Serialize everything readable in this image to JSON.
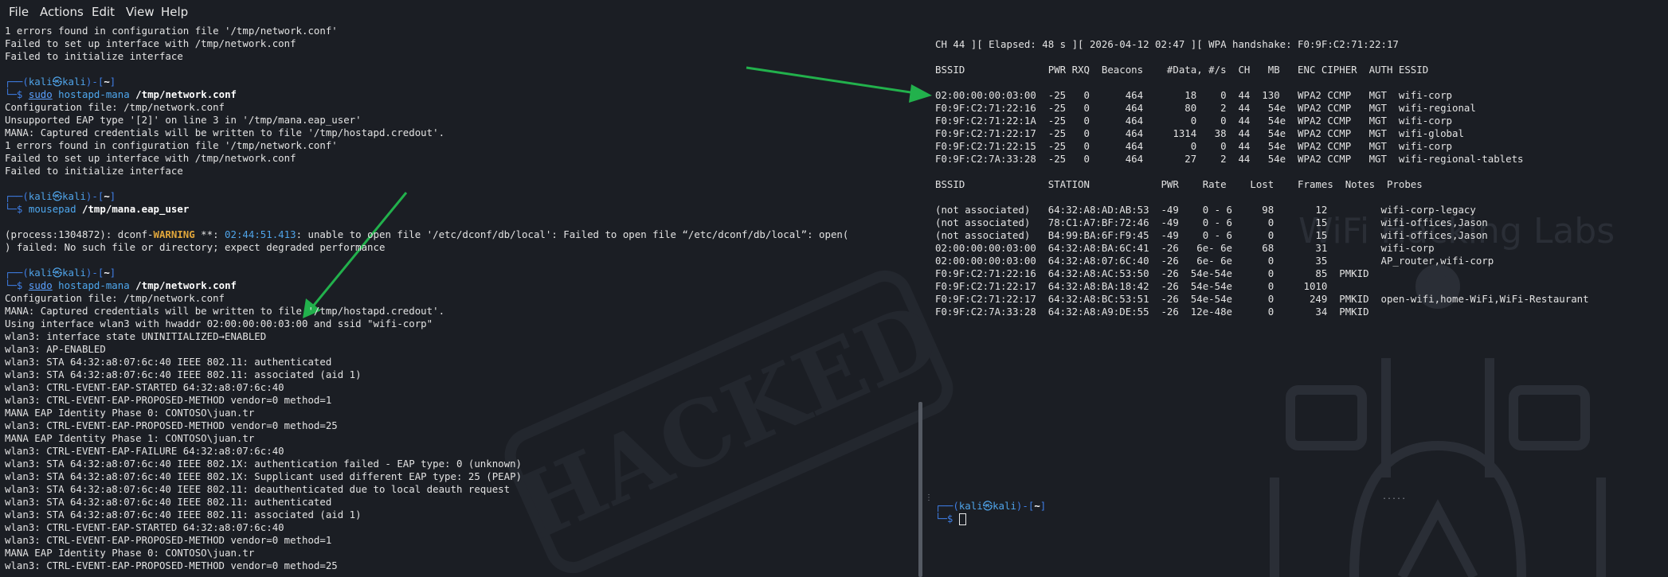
{
  "menu": [
    "File",
    "Actions",
    "Edit",
    "View",
    "Help"
  ],
  "prompt": {
    "user": "kali",
    "host": "kali",
    "dir": "~",
    "sep": "㉿"
  },
  "left": {
    "block1": [
      "1 errors found in configuration file '/tmp/network.conf'",
      "Failed to set up interface with /tmp/network.conf",
      "Failed to initialize interface"
    ],
    "cmd1": {
      "sudo": "sudo",
      "prog": "hostapd-mana",
      "arg": "/tmp/network.conf"
    },
    "block2": [
      "Configuration file: /tmp/network.conf",
      "Unsupported EAP type '[2]' on line 3 in '/tmp/mana.eap_user'",
      "MANA: Captured credentials will be written to file '/tmp/hostapd.credout'.",
      "1 errors found in configuration file '/tmp/network.conf'",
      "Failed to set up interface with /tmp/network.conf",
      "Failed to initialize interface"
    ],
    "cmd2": {
      "prog": "mousepad",
      "arg": "/tmp/mana.eap_user"
    },
    "warn_line": {
      "pre": "(process:1304872): dconf-",
      "warn": "WARNING",
      "mid": " **: ",
      "time": "02:44:51.413",
      "post": ": unable to open file '/etc/dconf/db/local': Failed to open file “/etc/dconf/db/local”: open("
    },
    "warn_cont": ") failed: No such file or directory; expect degraded performance",
    "cmd3": {
      "sudo": "sudo",
      "prog": "hostapd-mana",
      "arg": "/tmp/network.conf"
    },
    "block3": [
      "Configuration file: /tmp/network.conf",
      "MANA: Captured credentials will be written to file '/tmp/hostapd.credout'.",
      "Using interface wlan3 with hwaddr 02:00:00:00:03:00 and ssid \"wifi-corp\"",
      "wlan3: interface state UNINITIALIZED→ENABLED",
      "wlan3: AP-ENABLED",
      "wlan3: STA 64:32:a8:07:6c:40 IEEE 802.11: authenticated",
      "wlan3: STA 64:32:a8:07:6c:40 IEEE 802.11: associated (aid 1)",
      "wlan3: CTRL-EVENT-EAP-STARTED 64:32:a8:07:6c:40",
      "wlan3: CTRL-EVENT-EAP-PROPOSED-METHOD vendor=0 method=1",
      "MANA EAP Identity Phase 0: CONTOSO\\juan.tr",
      "wlan3: CTRL-EVENT-EAP-PROPOSED-METHOD vendor=0 method=25",
      "MANA EAP Identity Phase 1: CONTOSO\\juan.tr",
      "wlan3: CTRL-EVENT-EAP-FAILURE 64:32:a8:07:6c:40",
      "wlan3: STA 64:32:a8:07:6c:40 IEEE 802.1X: authentication failed - EAP type: 0 (unknown)",
      "wlan3: STA 64:32:a8:07:6c:40 IEEE 802.1X: Supplicant used different EAP type: 25 (PEAP)",
      "wlan3: STA 64:32:a8:07:6c:40 IEEE 802.11: deauthenticated due to local deauth request",
      "wlan3: STA 64:32:a8:07:6c:40 IEEE 802.11: authenticated",
      "wlan3: STA 64:32:a8:07:6c:40 IEEE 802.11: associated (aid 1)",
      "wlan3: CTRL-EVENT-EAP-STARTED 64:32:a8:07:6c:40",
      "wlan3: CTRL-EVENT-EAP-PROPOSED-METHOD vendor=0 method=1",
      "MANA EAP Identity Phase 0: CONTOSO\\juan.tr",
      "wlan3: CTRL-EVENT-EAP-PROPOSED-METHOD vendor=0 method=25"
    ]
  },
  "airodump": {
    "status": "CH 44 ][ Elapsed: 48 s ][ 2026-04-12 02:47 ][ WPA handshake: F0:9F:C2:71:22:17",
    "ap_header": "BSSID              PWR RXQ  Beacons    #Data, #/s  CH   MB   ENC CIPHER  AUTH ESSID",
    "ap_rows": [
      "02:00:00:00:03:00  -25   0      464       18    0  44  130   WPA2 CCMP   MGT  wifi-corp",
      "F0:9F:C2:71:22:16  -25   0      464       80    2  44   54e  WPA2 CCMP   MGT  wifi-regional",
      "F0:9F:C2:71:22:1A  -25   0      464        0    0  44   54e  WPA2 CCMP   MGT  wifi-corp",
      "F0:9F:C2:71:22:17  -25   0      464     1314   38  44   54e  WPA2 CCMP   MGT  wifi-global",
      "F0:9F:C2:71:22:15  -25   0      464        0    0  44   54e  WPA2 CCMP   MGT  wifi-corp",
      "F0:9F:C2:7A:33:28  -25   0      464       27    2  44   54e  WPA2 CCMP   MGT  wifi-regional-tablets"
    ],
    "sta_header": "BSSID              STATION            PWR    Rate    Lost    Frames  Notes  Probes",
    "sta_rows": [
      "(not associated)   64:32:A8:AD:AB:53  -49    0 - 6     98       12         wifi-corp-legacy",
      "(not associated)   78:C1:A7:BF:72:46  -49    0 - 6      0       15         wifi-offices,Jason",
      "(not associated)   B4:99:BA:6F:F9:45  -49    0 - 6      0       15         wifi-offices,Jason",
      "02:00:00:00:03:00  64:32:A8:BA:6C:41  -26   6e- 6e     68       31         wifi-corp",
      "02:00:00:00:03:00  64:32:A8:07:6C:40  -26   6e- 6e      0       35         AP_router,wifi-corp",
      "F0:9F:C2:71:22:16  64:32:A8:AC:53:50  -26  54e-54e      0       85  PMKID",
      "F0:9F:C2:71:22:17  64:32:A8:BA:18:42  -26  54e-54e      0     1010",
      "F0:9F:C2:71:22:17  64:32:A8:BC:53:51  -26  54e-54e      0      249  PMKID  open-wifi,home-WiFi,WiFi-Restaurant",
      "F0:9F:C2:7A:33:28  64:32:A8:A9:DE:55  -26  12e-48e      0       34  PMKID"
    ]
  },
  "watermark": {
    "stamp": "HACKED",
    "brand": "WiFi Hacking Labs"
  },
  "colors": {
    "bg": "#1b1e24",
    "text": "#e3e3e3",
    "prompt_blue": "#3f7fe6",
    "warning": "#e0a63b",
    "arrow": "#22b14c"
  }
}
